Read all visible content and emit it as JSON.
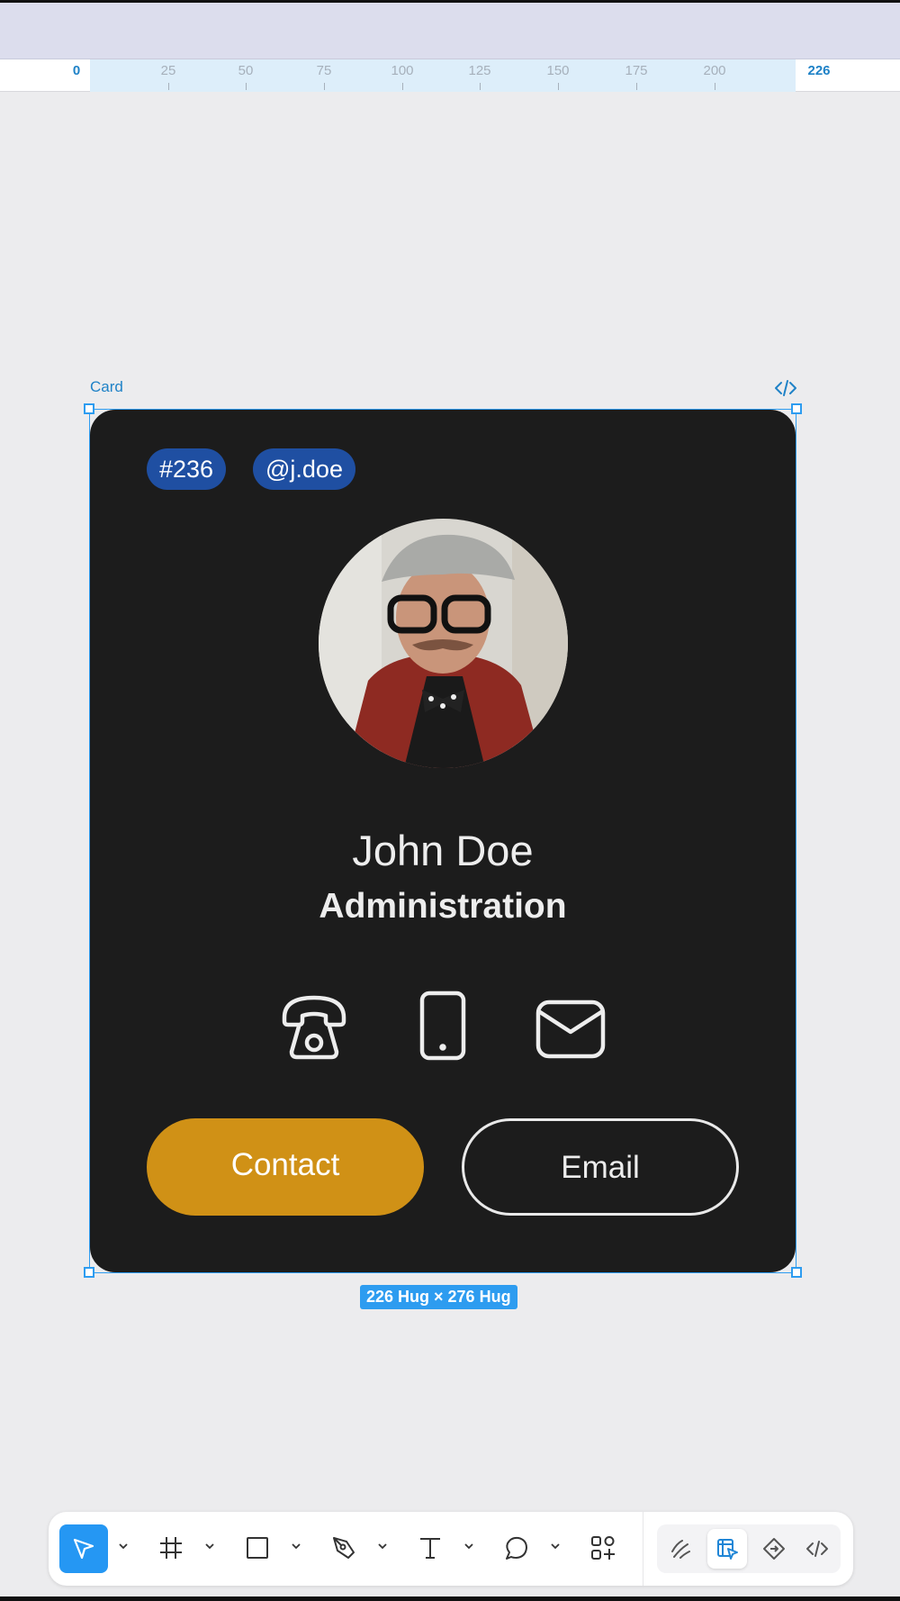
{
  "ruler": {
    "ticks": [
      "0",
      "25",
      "50",
      "75",
      "100",
      "125",
      "150",
      "175",
      "200",
      "226"
    ]
  },
  "frame": {
    "label": "Card",
    "code_icon": "code-icon",
    "size_badge": "226 Hug × 276 Hug"
  },
  "card": {
    "tags": [
      "#236",
      "@j.doe"
    ],
    "avatar_icon": "person-photo",
    "name": "John Doe",
    "department": "Administration",
    "contact_icons": [
      "telephone-icon",
      "mobile-phone-icon",
      "envelope-icon"
    ],
    "primary_button": "Contact",
    "secondary_button": "Email",
    "colors": {
      "background": "#1c1c1c",
      "tag": "#1f4fa2",
      "primary": "#d09116",
      "text": "#ededed"
    }
  },
  "toolbar": {
    "tools": [
      "pointer-icon",
      "frame-icon",
      "rectangle-icon",
      "pen-icon",
      "text-icon",
      "comment-icon",
      "components-icon"
    ],
    "modes": [
      "draw-icon",
      "design-icon",
      "prototype-icon",
      "dev-icon"
    ],
    "accent": "#2597f3"
  }
}
